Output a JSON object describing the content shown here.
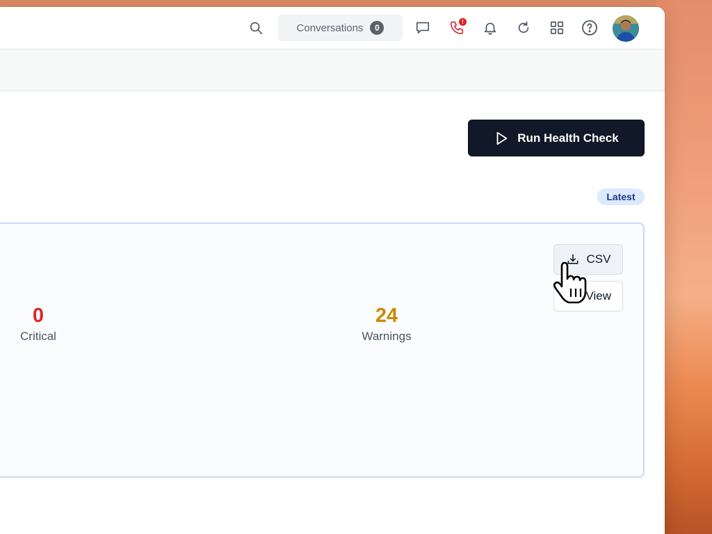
{
  "topbar": {
    "conversations_label": "Conversations",
    "conversations_count": "0",
    "phone_alert": "!"
  },
  "actions": {
    "run_health_check_label": "Run Health Check"
  },
  "report": {
    "badge": "Latest",
    "csv_label": "CSV",
    "view_label": "View",
    "stats": [
      {
        "value": "0",
        "label": "Critical",
        "color": "#dc2626"
      },
      {
        "value": "24",
        "label": "Warnings",
        "color": "#ca8a04"
      }
    ]
  },
  "colors": {
    "primary_dark": "#111827",
    "badge_bg": "#dbeafe",
    "card_border": "#c9daf2"
  }
}
